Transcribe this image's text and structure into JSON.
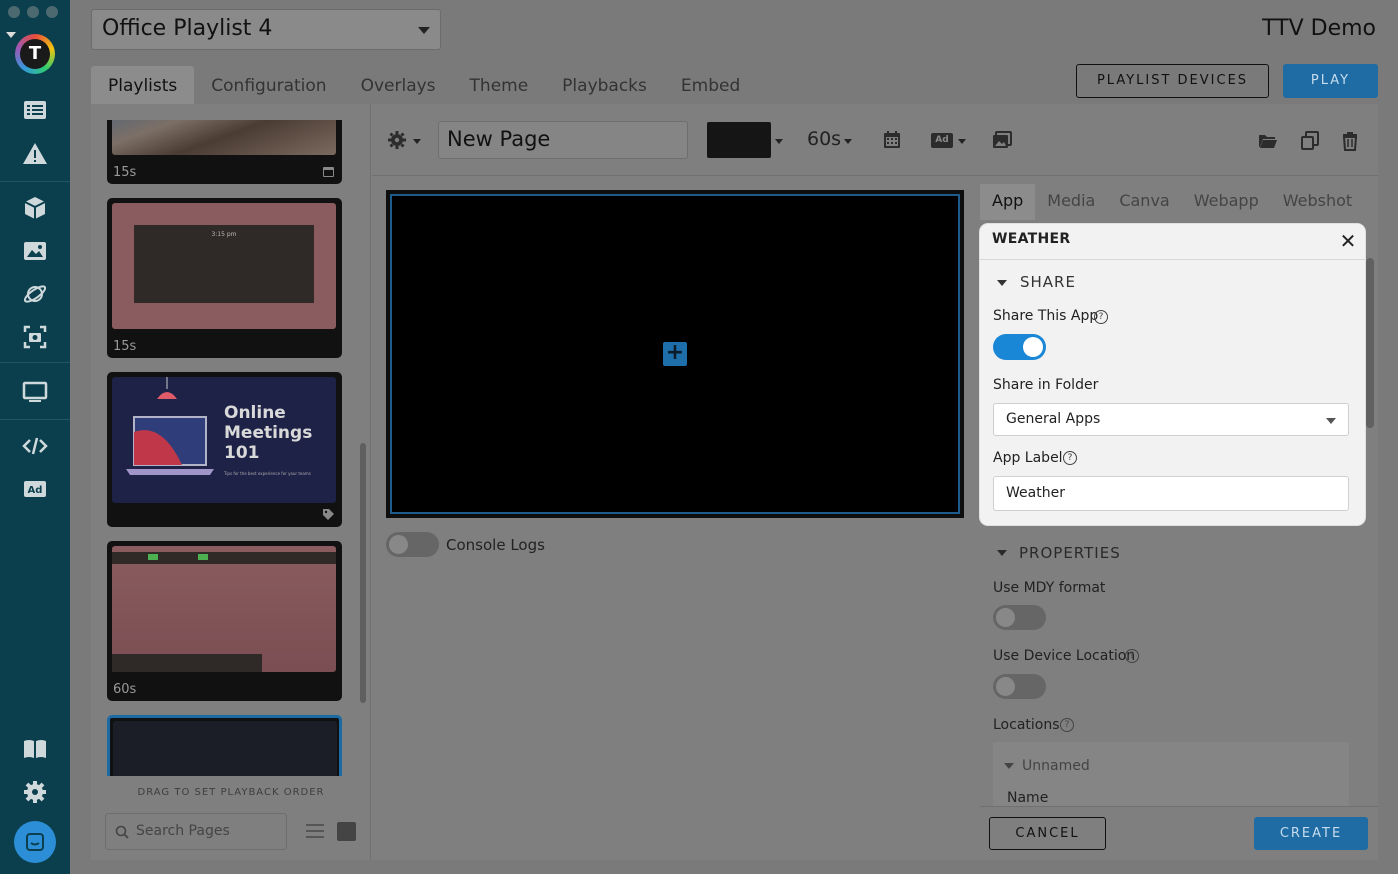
{
  "app": {
    "playlist_name": "Office Playlist 4",
    "org_name": "TTV Demo",
    "logo_letter": "T"
  },
  "tabs": [
    {
      "label": "Playlists",
      "active": true
    },
    {
      "label": "Configuration",
      "active": false
    },
    {
      "label": "Overlays",
      "active": false
    },
    {
      "label": "Theme",
      "active": false
    },
    {
      "label": "Playbacks",
      "active": false
    },
    {
      "label": "Embed",
      "active": false
    }
  ],
  "header_buttons": {
    "playlist_devices": "PLAYLIST DEVICES",
    "play": "PLAY"
  },
  "pages": {
    "items": [
      {
        "duration": "15s",
        "icon": "calendar-icon"
      },
      {
        "duration": "15s",
        "clock_text": "3:15 pm"
      },
      {
        "duration": "",
        "title_line1": "Online",
        "title_line2": "Meetings",
        "title_line3": "101",
        "subtitle": "Tips for the best experience for your teams",
        "icon": "tag-icon"
      },
      {
        "duration": "60s"
      },
      {
        "duration": ""
      }
    ],
    "drag_hint": "DRAG TO SET PLAYBACK ORDER",
    "search_placeholder": "Search Pages"
  },
  "editor": {
    "page_name": "New Page",
    "duration": "60s",
    "ad_badge": "Ad",
    "console_logs_label": "Console Logs",
    "canvas_color": "#000000"
  },
  "right_tabs": [
    {
      "label": "App",
      "active": true
    },
    {
      "label": "Media",
      "active": false
    },
    {
      "label": "Canva",
      "active": false
    },
    {
      "label": "Webapp",
      "active": false
    },
    {
      "label": "Webshot",
      "active": false
    }
  ],
  "weather_popup": {
    "title": "WEATHER",
    "share_section": "SHARE",
    "share_this_app_label": "Share This App",
    "share_this_app_on": true,
    "share_in_folder_label": "Share in Folder",
    "share_in_folder_value": "General Apps",
    "app_label_label": "App Label",
    "app_label_value": "Weather"
  },
  "properties": {
    "section": "PROPERTIES",
    "use_mdy_label": "Use MDY format",
    "use_mdy_on": false,
    "use_device_location_label": "Use Device Location",
    "use_device_location_on": false,
    "locations_label": "Locations",
    "location_group": "Unnamed",
    "name_label": "Name"
  },
  "footer": {
    "cancel": "CANCEL",
    "create": "CREATE"
  },
  "colors": {
    "nav_bg": "#0b3f4d",
    "accent": "#1f6ca5",
    "toggle_on": "#1a86d6"
  }
}
